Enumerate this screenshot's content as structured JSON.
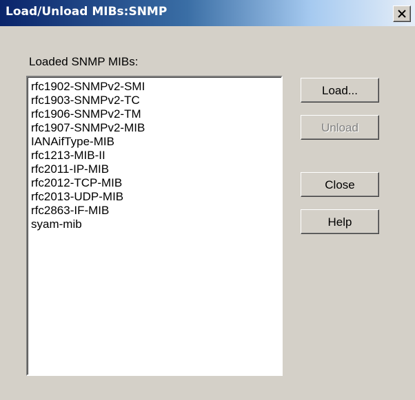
{
  "window": {
    "title": "Load/Unload MIBs:SNMP"
  },
  "list": {
    "label": "Loaded SNMP MIBs:",
    "items": [
      "rfc1902-SNMPv2-SMI",
      "rfc1903-SNMPv2-TC",
      "rfc1906-SNMPv2-TM",
      "rfc1907-SNMPv2-MIB",
      "IANAifType-MIB",
      "rfc1213-MIB-II",
      "rfc2011-IP-MIB",
      "rfc2012-TCP-MIB",
      "rfc2013-UDP-MIB",
      "rfc2863-IF-MIB",
      "syam-mib"
    ]
  },
  "buttons": {
    "load": "Load...",
    "unload": "Unload",
    "close": "Close",
    "help": "Help"
  },
  "states": {
    "unload_enabled": false
  },
  "icons": {
    "close": "close-icon"
  },
  "colors": {
    "face": "#d4d0c8",
    "title_active": "#0a246a",
    "disabled_text": "#808080"
  }
}
